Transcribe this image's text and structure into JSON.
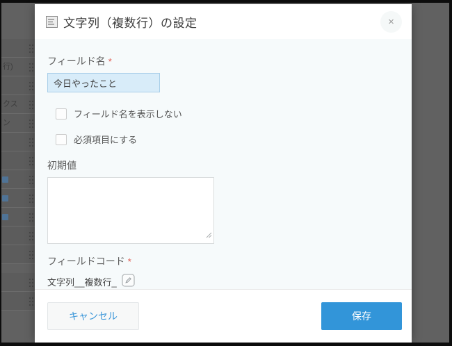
{
  "background_list": {
    "rows": [
      {
        "fragment": ""
      },
      {
        "fragment": "行)"
      },
      {
        "fragment": ""
      },
      {
        "fragment": "クス"
      },
      {
        "fragment": "ン"
      },
      {
        "fragment": ""
      },
      {
        "fragment": ""
      },
      {
        "fragment": "",
        "icon": true
      },
      {
        "fragment": "",
        "icon": true
      },
      {
        "fragment": "",
        "icon": true
      },
      {
        "fragment": ""
      },
      {
        "fragment": ""
      },
      {
        "gap": true
      },
      {
        "fragment": ""
      },
      {
        "fragment": ""
      }
    ]
  },
  "modal": {
    "title": "文字列（複数行）の設定",
    "close_glyph": "×",
    "field_name": {
      "label": "フィールド名",
      "required_mark": "*",
      "value": "今日やったこと"
    },
    "options": [
      {
        "label": "フィールド名を表示しない",
        "checked": false
      },
      {
        "label": "必須項目にする",
        "checked": false
      }
    ],
    "initial_value": {
      "label": "初期値",
      "value": ""
    },
    "field_code": {
      "label": "フィールドコード",
      "required_mark": "*",
      "value": "文字列__複数行_"
    },
    "footer": {
      "cancel_label": "キャンセル",
      "save_label": "保存"
    }
  },
  "colors": {
    "accent_blue": "#3295d9",
    "required_red": "#e0584d",
    "field_name_input_bg": "#d8ecf9",
    "overlay_gray": "#616161"
  }
}
